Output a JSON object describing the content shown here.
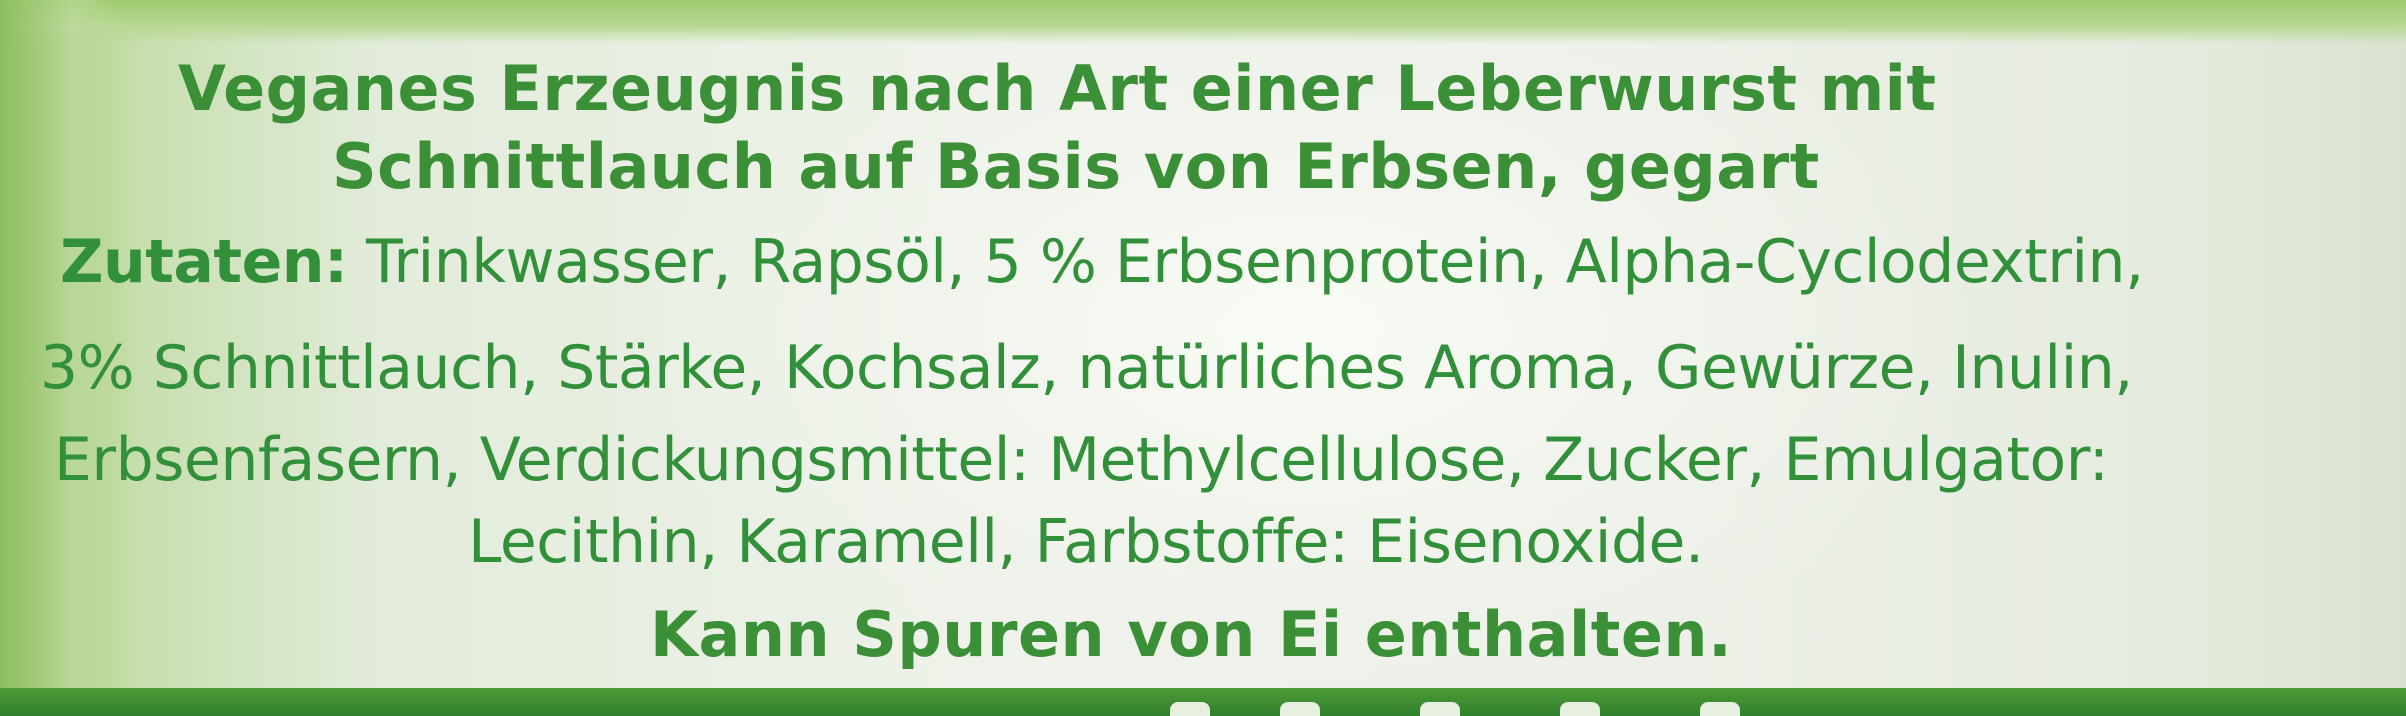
{
  "title": {
    "line1": "Veganes Erzeugnis nach Art einer Leberwurst mit",
    "line2": "Schnittlauch auf Basis von Erbsen, gegart"
  },
  "ingredients": {
    "label": "Zutaten:",
    "line1_rest": " Trinkwasser, Rapsöl, 5 % Erbsenprotein, Alpha-Cyclodextrin,",
    "line2": "3% Schnittlauch, Stärke, Kochsalz, natürliches Aroma, Gewürze, Inulin,",
    "line3": "Erbsenfasern, Verdickungsmittel: Methylcellulose, Zucker, Emulgator:",
    "line4": "Lecithin, Karamell, Farbstoffe: Eisenoxide."
  },
  "allergen_note": "Kann Spuren von Ei enthalten.",
  "colors": {
    "text_green": "#33903a",
    "band_green": "#2f7f2a",
    "background": "#eef2ea"
  }
}
